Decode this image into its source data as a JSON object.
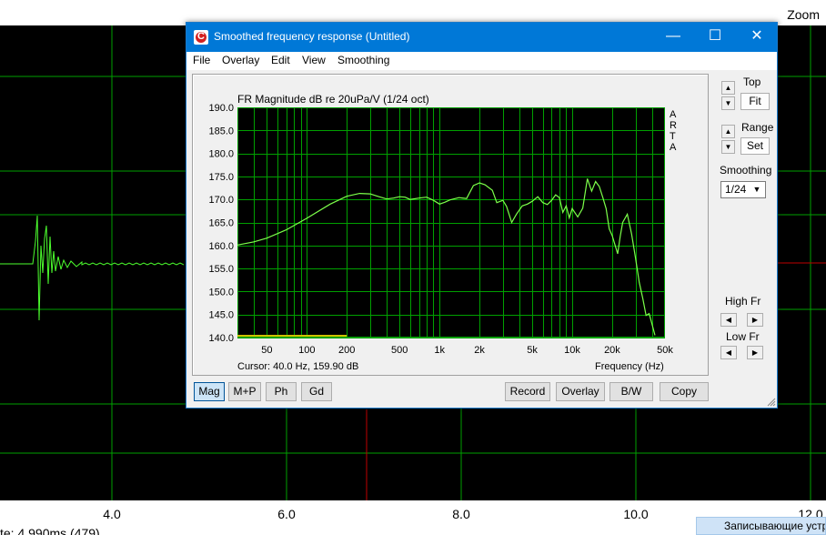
{
  "background_window": {
    "zoom_label": "Zoom",
    "x_ticks": [
      "4.0",
      "6.0",
      "8.0",
      "10.0",
      "12.0"
    ],
    "status_text": "te: 4.990ms (479)",
    "taskbar_text": "Записывающие устр"
  },
  "dialog": {
    "title": "Smoothed frequency response (Untitled)",
    "icon_letter": "C",
    "window_buttons": {
      "minimize": "—",
      "maximize": "☐",
      "close": "✕"
    },
    "menu": [
      "File",
      "Overlay",
      "Edit",
      "View",
      "Smoothing"
    ],
    "plot_title": "FR Magnitude dB re 20uPa/V (1/24 oct)",
    "arta_letters": [
      "A",
      "R",
      "T",
      "A"
    ],
    "cursor_text": "Cursor: 40.0 Hz, 159.90 dB",
    "x_axis_label": "Frequency (Hz)",
    "right_panel": {
      "top_label": "Top",
      "fit_button": "Fit",
      "range_label": "Range",
      "set_button": "Set",
      "smoothing_label": "Smoothing",
      "smoothing_value": "1/24",
      "high_fr_label": "High Fr",
      "low_fr_label": "Low Fr"
    },
    "bottom_buttons": {
      "mag": "Mag",
      "mp": "M+P",
      "ph": "Ph",
      "gd": "Gd",
      "record": "Record",
      "overlay": "Overlay",
      "bw": "B/W",
      "copy": "Copy"
    }
  },
  "chart_data": {
    "type": "line",
    "title": "FR Magnitude dB re 20uPa/V (1/24 oct)",
    "xlabel": "Frequency (Hz)",
    "ylabel": "",
    "xscale": "log",
    "xlim": [
      30,
      50000
    ],
    "ylim": [
      140,
      190
    ],
    "y_ticks": [
      "190.0",
      "185.0",
      "180.0",
      "175.0",
      "170.0",
      "165.0",
      "160.0",
      "155.0",
      "150.0",
      "145.0",
      "140.0"
    ],
    "x_ticks": [
      {
        "value": 50,
        "label": "50"
      },
      {
        "value": 100,
        "label": "100"
      },
      {
        "value": 200,
        "label": "200"
      },
      {
        "value": 500,
        "label": "500"
      },
      {
        "value": 1000,
        "label": "1k"
      },
      {
        "value": 2000,
        "label": "2k"
      },
      {
        "value": 5000,
        "label": "5k"
      },
      {
        "value": 10000,
        "label": "10k"
      },
      {
        "value": 20000,
        "label": "20k"
      },
      {
        "value": 50000,
        "label": "50k"
      }
    ],
    "grid": true,
    "background": "#000000",
    "grid_color": "#00a000",
    "line_color": "#7cff4a",
    "marker_color": "#d0c000",
    "series": [
      {
        "points": [
          [
            30,
            160.1
          ],
          [
            40,
            160.8
          ],
          [
            50,
            161.6
          ],
          [
            70,
            163.4
          ],
          [
            100,
            165.9
          ],
          [
            150,
            169.0
          ],
          [
            200,
            170.7
          ],
          [
            250,
            171.3
          ],
          [
            300,
            171.2
          ],
          [
            350,
            170.6
          ],
          [
            400,
            170.1
          ],
          [
            450,
            170.3
          ],
          [
            500,
            170.6
          ],
          [
            550,
            170.5
          ],
          [
            600,
            170.0
          ],
          [
            700,
            170.3
          ],
          [
            800,
            170.5
          ],
          [
            900,
            169.8
          ],
          [
            1000,
            169.0
          ],
          [
            1100,
            169.4
          ],
          [
            1200,
            169.9
          ],
          [
            1400,
            170.4
          ],
          [
            1600,
            170.2
          ],
          [
            1800,
            173.0
          ],
          [
            2000,
            173.6
          ],
          [
            2200,
            173.2
          ],
          [
            2500,
            172.0
          ],
          [
            2700,
            169.3
          ],
          [
            3000,
            169.8
          ],
          [
            3200,
            168.5
          ],
          [
            3500,
            165.0
          ],
          [
            3800,
            166.8
          ],
          [
            4200,
            168.6
          ],
          [
            4600,
            169.0
          ],
          [
            5000,
            169.6
          ],
          [
            5500,
            170.6
          ],
          [
            6000,
            169.3
          ],
          [
            6500,
            168.9
          ],
          [
            7000,
            169.8
          ],
          [
            7500,
            171.0
          ],
          [
            8000,
            170.4
          ],
          [
            8500,
            167.2
          ],
          [
            9000,
            168.6
          ],
          [
            9500,
            166.0
          ],
          [
            10000,
            168.0
          ],
          [
            11000,
            166.2
          ],
          [
            12000,
            168.1
          ],
          [
            13000,
            174.5
          ],
          [
            14000,
            171.8
          ],
          [
            15000,
            173.9
          ],
          [
            16000,
            172.8
          ],
          [
            17000,
            170.4
          ],
          [
            18000,
            168.0
          ],
          [
            19000,
            163.6
          ],
          [
            20000,
            162.2
          ],
          [
            22000,
            158.2
          ],
          [
            23000,
            162.0
          ],
          [
            24000,
            165.0
          ],
          [
            26000,
            166.8
          ],
          [
            28000,
            162.5
          ],
          [
            30000,
            157.3
          ],
          [
            32000,
            152.0
          ],
          [
            34000,
            148.5
          ],
          [
            36000,
            144.8
          ],
          [
            38000,
            145.2
          ],
          [
            40000,
            142.8
          ],
          [
            42000,
            140.5
          ]
        ]
      }
    ],
    "overlay_bar": {
      "from": 30,
      "to": 200,
      "value": 140.4
    }
  }
}
